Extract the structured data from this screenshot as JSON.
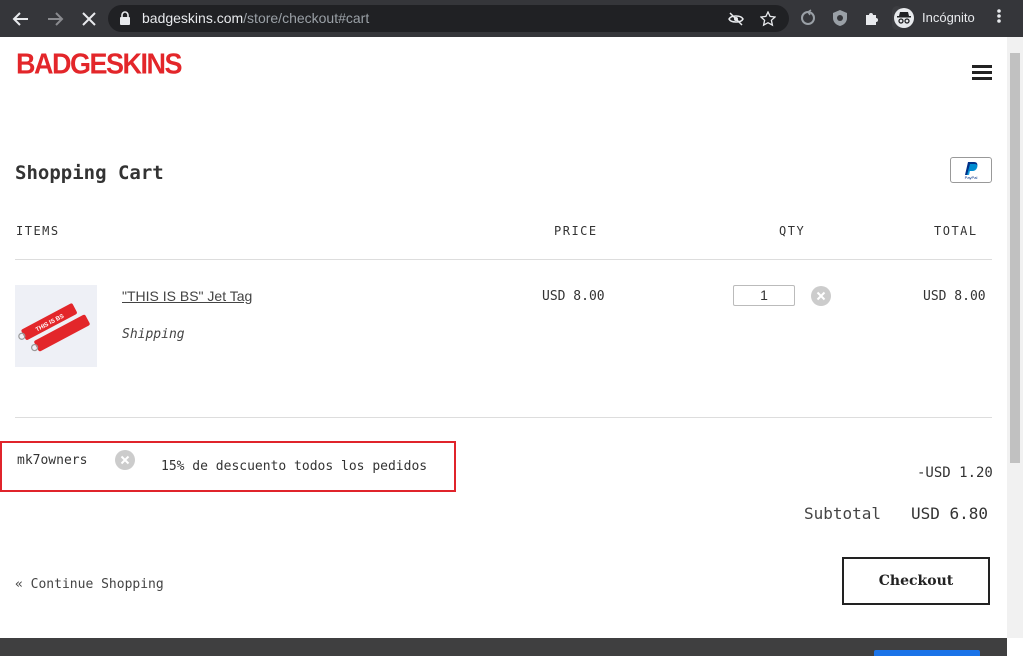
{
  "browser": {
    "url_domain": "badgeskins.com",
    "url_path": "/store/checkout#cart",
    "incognito_label": "Incógnito"
  },
  "site": {
    "logo_text": "BADGESKINS"
  },
  "cart": {
    "title": "Shopping Cart",
    "columns": {
      "items": "ITEMS",
      "price": "PRICE",
      "qty": "QTY",
      "total": "TOTAL"
    },
    "line_items": [
      {
        "name": "\"THIS IS BS\" Jet Tag",
        "note": "Shipping",
        "price": "USD 8.00",
        "qty": "1",
        "total": "USD 8.00",
        "tag_text": "THIS IS BS"
      }
    ],
    "coupon": {
      "code": "mk7owners",
      "description": "15% de descuento todos los pedidos",
      "amount": "-USD 1.20"
    },
    "subtotal_label": "Subtotal",
    "subtotal_value": "USD 6.80",
    "continue_label": "« Continue Shopping",
    "checkout_label": "Checkout"
  },
  "colors": {
    "brand_red": "#e3262a",
    "highlight_border": "#e0242b",
    "chrome_bg": "#35363a"
  },
  "icons": [
    "back-arrow-icon",
    "forward-arrow-icon",
    "close-loading-icon",
    "lock-icon",
    "eye-off-icon",
    "star-icon",
    "sync-icon",
    "shield-icon",
    "puzzle-icon",
    "incognito-icon",
    "more-vert-icon",
    "hamburger-menu-icon",
    "paypal-icon",
    "remove-x-icon"
  ]
}
